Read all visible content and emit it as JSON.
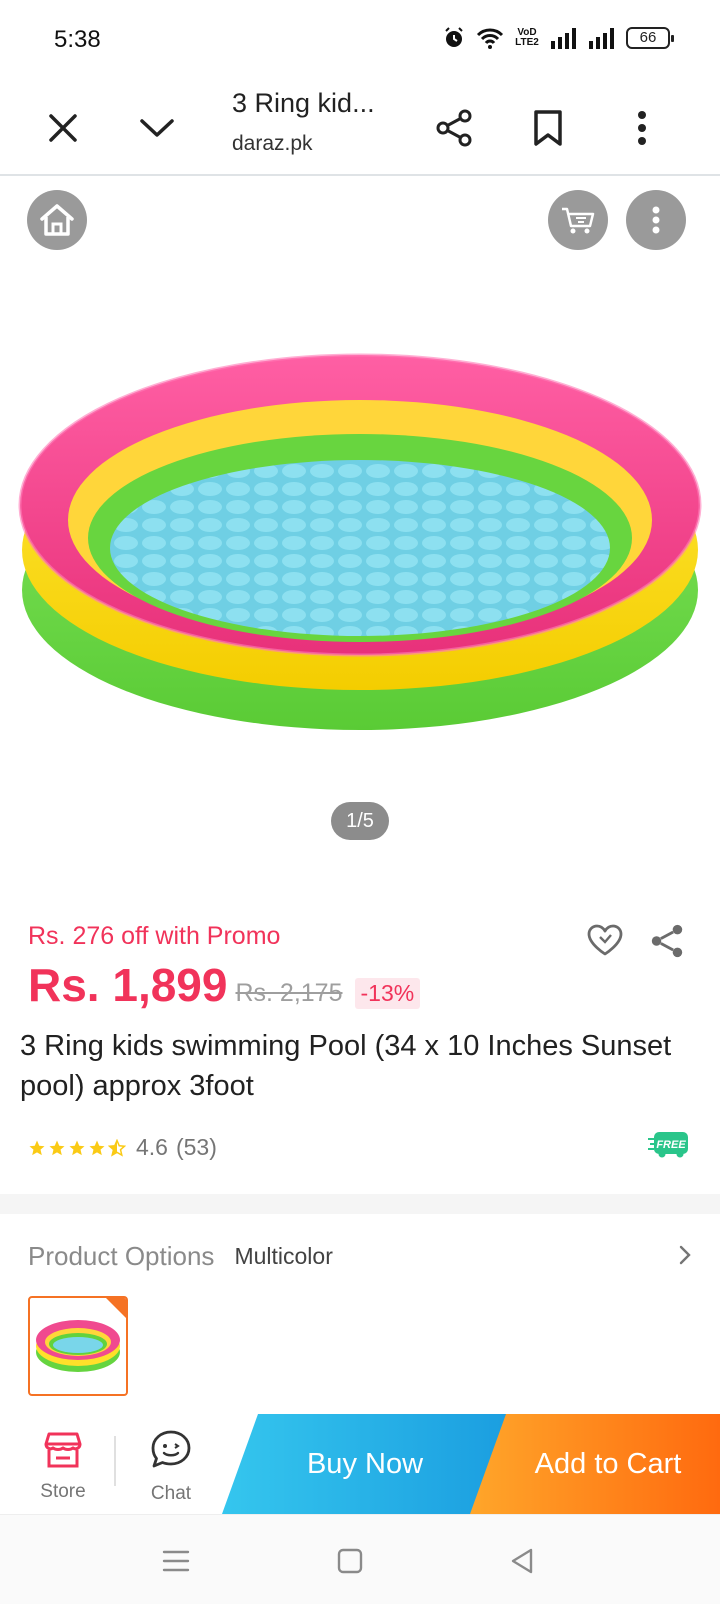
{
  "status_bar": {
    "time": "5:38",
    "network_label_top": "VoD",
    "network_label_bottom": "LTE2",
    "battery": "66"
  },
  "toolbar": {
    "page_title": "3 Ring kid...",
    "url": "daraz.pk"
  },
  "gallery": {
    "page_indicator": "1/5"
  },
  "product": {
    "promo_text": "Rs. 276 off with Promo",
    "price": "Rs. 1,899",
    "original_price": "Rs. 2,175",
    "discount": "-13%",
    "title": "3 Ring kids swimming Pool (34 x 10 Inches Sunset pool) approx 3foot",
    "rating": "4.6",
    "review_count": "(53)",
    "stars": 4.5,
    "shipping_badge": "FREE"
  },
  "options": {
    "label": "Product Options",
    "value": "Multicolor"
  },
  "action_bar": {
    "store_label": "Store",
    "chat_label": "Chat",
    "buy_now_label": "Buy Now",
    "add_to_cart_label": "Add to Cart"
  },
  "colors": {
    "accent_pink": "#f1335a",
    "buy_now": "#1b9ee0",
    "add_to_cart": "#ff6a0f",
    "selected_border": "#f57224"
  }
}
